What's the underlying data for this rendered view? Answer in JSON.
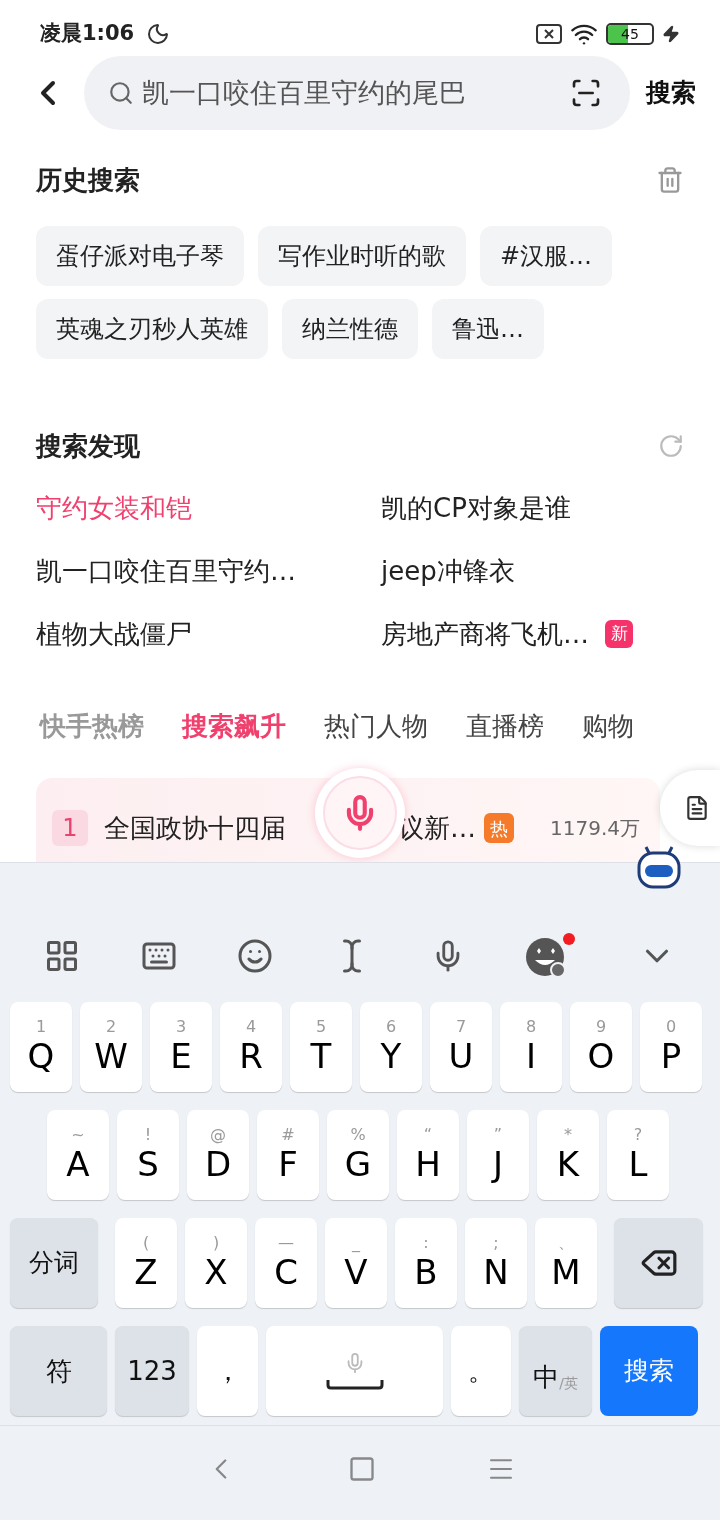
{
  "status_bar": {
    "time": "凌晨1:06",
    "battery": "45"
  },
  "search": {
    "value": "凯一口咬住百里守约的尾巴",
    "button": "搜索"
  },
  "history": {
    "title": "历史搜索",
    "rows": [
      [
        "蛋仔派对电子琴",
        "写作业时听的歌",
        "#汉服…"
      ],
      [
        "英魂之刃秒人英雄",
        "纳兰性德",
        "鲁迅…"
      ]
    ]
  },
  "discover": {
    "title": "搜索发现",
    "items": [
      {
        "text": "守约女装和铠",
        "highlighted": true
      },
      {
        "text": "凯的CP对象是谁",
        "highlighted": false
      },
      {
        "text": "凯一口咬住百里守约…",
        "highlighted": false
      },
      {
        "text": "jeep冲锋衣",
        "highlighted": false
      },
      {
        "text": "植物大战僵尸",
        "highlighted": false
      },
      {
        "text": "房地产商将飞机…",
        "highlighted": false,
        "badge": "新"
      }
    ]
  },
  "ranking_tabs": [
    {
      "label": "快手热榜",
      "selected": false
    },
    {
      "label": "搜索飙升",
      "selected": true
    },
    {
      "label": "热门人物",
      "selected": false
    },
    {
      "label": "直播榜",
      "selected": false
    },
    {
      "label": "购物",
      "selected": false
    }
  ],
  "hot_item": {
    "rank": "1",
    "title_parts": [
      "全国政协十四届",
      "议新…"
    ],
    "badge": "热",
    "count": "1179.4万"
  },
  "keyboard": {
    "rows": [
      [
        {
          "label": "Q",
          "hint": "1"
        },
        {
          "label": "W",
          "hint": "2"
        },
        {
          "label": "E",
          "hint": "3"
        },
        {
          "label": "R",
          "hint": "4"
        },
        {
          "label": "T",
          "hint": "5"
        },
        {
          "label": "Y",
          "hint": "6"
        },
        {
          "label": "U",
          "hint": "7"
        },
        {
          "label": "I",
          "hint": "8"
        },
        {
          "label": "O",
          "hint": "9"
        },
        {
          "label": "P",
          "hint": "0"
        }
      ],
      [
        {
          "label": "A",
          "hint": "~"
        },
        {
          "label": "S",
          "hint": "!"
        },
        {
          "label": "D",
          "hint": "@"
        },
        {
          "label": "F",
          "hint": "#"
        },
        {
          "label": "G",
          "hint": "%"
        },
        {
          "label": "H",
          "hint": "“"
        },
        {
          "label": "J",
          "hint": "”"
        },
        {
          "label": "K",
          "hint": "*"
        },
        {
          "label": "L",
          "hint": "?"
        }
      ],
      [
        {
          "label": "Z",
          "hint": "("
        },
        {
          "label": "X",
          "hint": ")"
        },
        {
          "label": "C",
          "hint": "—"
        },
        {
          "label": "V",
          "hint": "_"
        },
        {
          "label": "B",
          "hint": ":"
        },
        {
          "label": "N",
          "hint": ";"
        },
        {
          "label": "M",
          "hint": "、"
        }
      ]
    ],
    "segment_key": "分词",
    "symbol_key": "符",
    "number_key": "123",
    "comma_key": "，",
    "period_key": "。",
    "lang_key": {
      "main": "中",
      "alt": "/英"
    },
    "enter_key": "搜索"
  }
}
